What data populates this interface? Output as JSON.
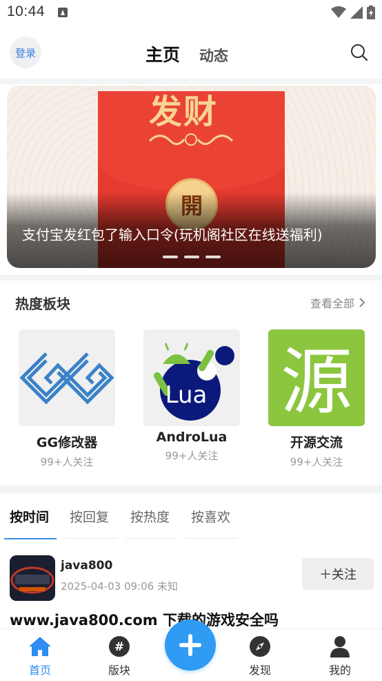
{
  "status_bar": {
    "time": "10:44"
  },
  "header": {
    "login_label": "登录",
    "tab_home": "主页",
    "tab_dynamic": "动态"
  },
  "banner": {
    "image_text_top": "发财",
    "image_seal_text": "開",
    "caption": "支付宝发红包了输入口令(玩机阁社区在线送福利)",
    "page_count": 3
  },
  "hot_boards": {
    "title": "热度板块",
    "view_all": "查看全部",
    "items": [
      {
        "name": "GG修改器",
        "followers": "99+人关注",
        "icon": "gg-logo-icon"
      },
      {
        "name": "AndroLua",
        "followers": "99+人关注",
        "icon": "androlua-logo-icon",
        "logo_text": "Lua"
      },
      {
        "name": "开源交流",
        "followers": "99+人关注",
        "icon": "open-source-logo-icon",
        "logo_text": "源"
      }
    ]
  },
  "sort_tabs": [
    "按时间",
    "按回复",
    "按热度",
    "按喜欢"
  ],
  "post": {
    "author": "java800",
    "meta": "2025-04-03 09:06 未知",
    "follow_label": "＋关注",
    "title": "www.java800.com 下载的游戏安全吗"
  },
  "bottom_nav": {
    "items": [
      {
        "label": "首页",
        "icon": "home-icon",
        "active": true
      },
      {
        "label": "版块",
        "icon": "hashtag-icon",
        "active": false
      },
      {
        "label": "发现",
        "icon": "compass-icon",
        "active": false
      },
      {
        "label": "我的",
        "icon": "user-icon",
        "active": false
      }
    ]
  },
  "colors": {
    "accent": "#2f8cf0",
    "fab": "#2f9bf3",
    "banner_red": "#e53a2f",
    "gold": "#f7d592"
  }
}
